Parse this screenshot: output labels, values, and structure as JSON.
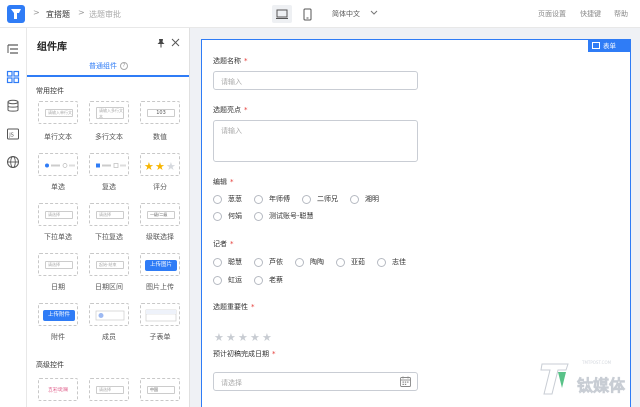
{
  "header": {
    "app_name": "宜搭题",
    "page_name": "选题审批",
    "language": "简体中文",
    "page_settings": "页面设置",
    "shortcuts": "快捷键",
    "help": "帮助"
  },
  "panel": {
    "title": "组件库",
    "tab_basic": "普通组件",
    "section_common": "常用控件",
    "section_advanced": "高级控件",
    "components": [
      {
        "label": "单行文本",
        "preview": "请输入单行文本"
      },
      {
        "label": "多行文本",
        "preview": "请输入多行文本"
      },
      {
        "label": "数值",
        "preview": "103"
      },
      {
        "label": "单选",
        "preview": "选项一"
      },
      {
        "label": "复选",
        "preview": "选项一"
      },
      {
        "label": "评分",
        "preview": ""
      },
      {
        "label": "下拉单选",
        "preview": "请选择"
      },
      {
        "label": "下拉复选",
        "preview": "请选择"
      },
      {
        "label": "级联选择",
        "preview": "一级/二级"
      },
      {
        "label": "日期",
        "preview": "请选择"
      },
      {
        "label": "日期区间",
        "preview": "起始-结束"
      },
      {
        "label": "图片上传",
        "preview": "上传图片"
      },
      {
        "label": "附件",
        "preview": "上传附件"
      },
      {
        "label": "成员",
        "preview": ""
      },
      {
        "label": "子表单",
        "preview": ""
      }
    ],
    "advanced": [
      {
        "preview": "五彩斑斓的黑"
      },
      {
        "preview": "请选择"
      },
      {
        "preview": "中国"
      }
    ]
  },
  "form": {
    "badge": "表单",
    "fields": {
      "topic_name": {
        "label": "选题名称",
        "placeholder": "请输入"
      },
      "topic_highlight": {
        "label": "选题亮点",
        "placeholder": "请输入"
      },
      "editor": {
        "label": "编辑",
        "options": [
          "葱葱",
          "年师傅",
          "二师兄",
          "湘明",
          "何娟",
          "测试账号-聪慧"
        ]
      },
      "reporter": {
        "label": "记者",
        "options": [
          "聪慧",
          "芦依",
          "陶陶",
          "亚茹",
          "志佳",
          "虹运",
          "老蔡"
        ]
      },
      "importance": {
        "label": "选题重要性",
        "max_stars": 5,
        "value": 0
      },
      "expected_date": {
        "label": "预计初稿完成日期",
        "placeholder": "请选择"
      }
    }
  },
  "watermark": {
    "text": "钛媒体",
    "sub": "TMTPOST.COM"
  },
  "colors": {
    "accent": "#2f7cf6",
    "required": "#e53935",
    "star": "#f7b500"
  }
}
